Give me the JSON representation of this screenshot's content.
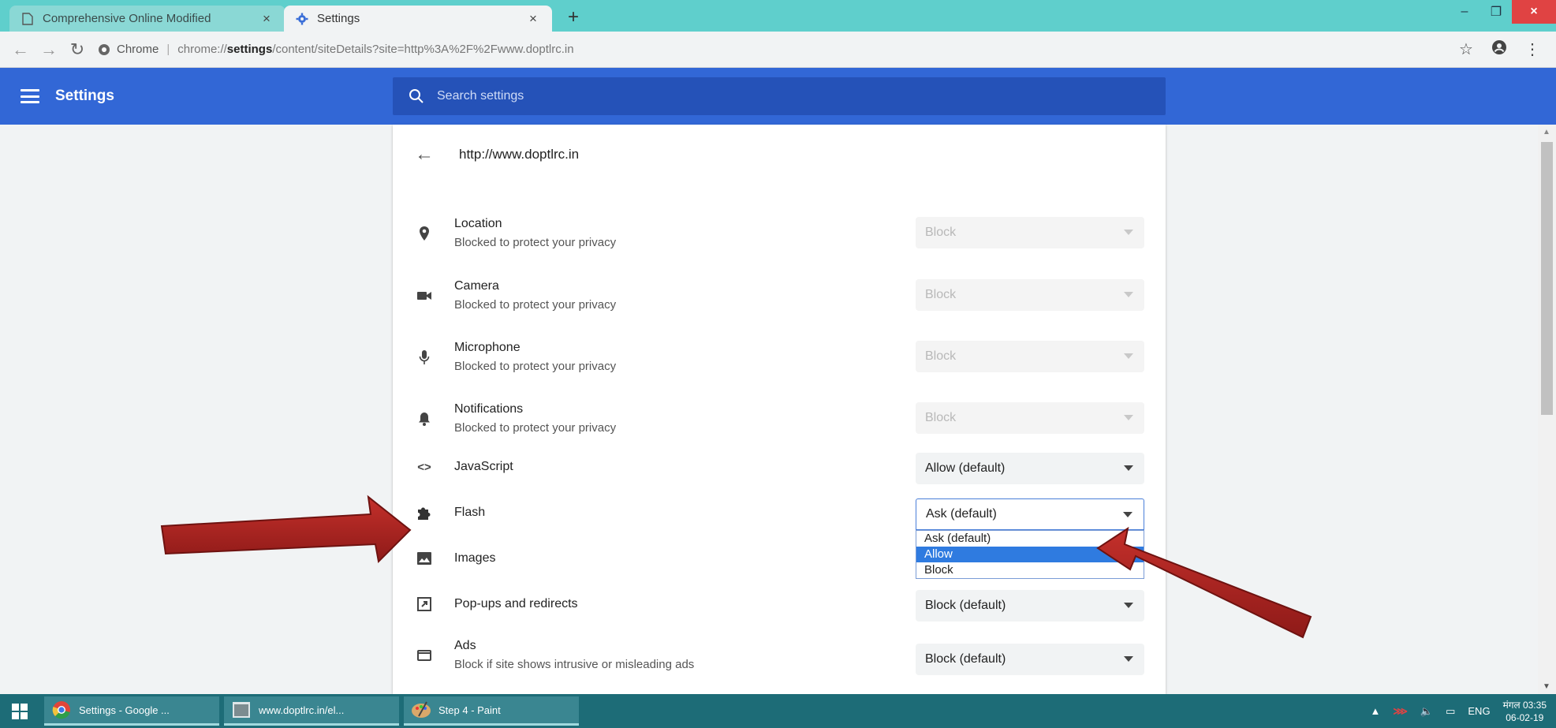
{
  "browser": {
    "tabs": [
      {
        "title": "Comprehensive Online Modified",
        "close": "×"
      },
      {
        "title": "Settings",
        "close": "×"
      }
    ],
    "new_tab": "+",
    "window_controls": {
      "minimize": "–",
      "restore": "❐",
      "close": "×"
    },
    "omnibox": {
      "chip": "Chrome",
      "separator": "|",
      "url_scheme": "chrome://",
      "url_host": "settings",
      "url_rest": "/content/siteDetails?site=http%3A%2F%2Fwww.doptlrc.in"
    }
  },
  "settings": {
    "title": "Settings",
    "search_placeholder": "Search settings",
    "site": "http://www.doptlrc.in",
    "permissions": [
      {
        "name": "Location",
        "sub": "Blocked to protect your privacy",
        "value": "Block",
        "icon": "location-icon"
      },
      {
        "name": "Camera",
        "sub": "Blocked to protect your privacy",
        "value": "Block",
        "icon": "camera-icon"
      },
      {
        "name": "Microphone",
        "sub": "Blocked to protect your privacy",
        "value": "Block",
        "icon": "microphone-icon"
      },
      {
        "name": "Notifications",
        "sub": "Blocked to protect your privacy",
        "value": "Block",
        "icon": "bell-icon"
      },
      {
        "name": "JavaScript",
        "value": "Allow (default)",
        "icon": "code-icon"
      },
      {
        "name": "Flash",
        "value": "Ask (default)",
        "icon": "puzzle-icon"
      },
      {
        "name": "Images",
        "icon": "image-icon"
      },
      {
        "name": "Pop-ups and redirects",
        "value": "Block (default)",
        "icon": "popup-icon"
      },
      {
        "name": "Ads",
        "sub": "Block if site shows intrusive or misleading ads",
        "value": "Block (default)",
        "icon": "ads-icon"
      }
    ],
    "flash_dropdown": {
      "options": [
        "Ask (default)",
        "Allow",
        "Block"
      ],
      "highlighted": "Allow"
    }
  },
  "taskbar": {
    "items": [
      "Settings - Google ...",
      "www.doptlrc.in/el...",
      "Step 4 - Paint"
    ],
    "tray": {
      "lang": "ENG",
      "time": "मंगल 03:35",
      "date": "06-02-19"
    }
  },
  "colors": {
    "header_blue": "#3267d6",
    "annotation_arrow": "#b5211f",
    "highlight": "#2f7be0"
  }
}
